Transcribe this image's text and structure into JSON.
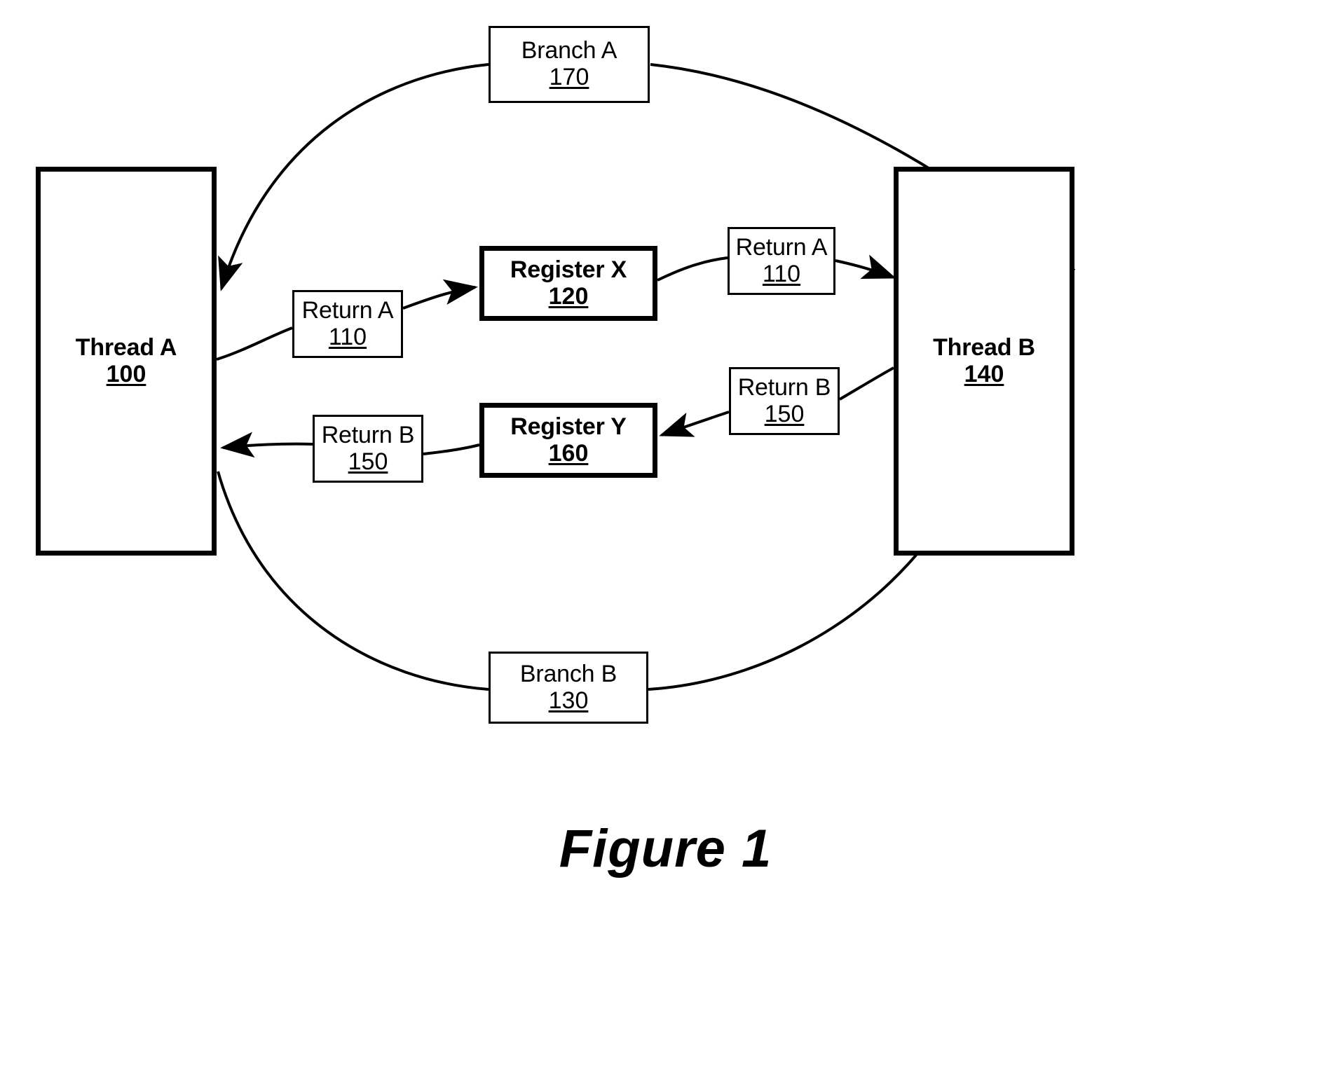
{
  "figure": {
    "caption": "Figure 1"
  },
  "nodes": {
    "branch_a": {
      "label": "Branch A",
      "number": "170"
    },
    "thread_a": {
      "label": "Thread A",
      "number": "100"
    },
    "thread_b": {
      "label": "Thread B",
      "number": "140"
    },
    "register_x": {
      "label": "Register X",
      "number": "120"
    },
    "register_y": {
      "label": "Register Y",
      "number": "160"
    },
    "return_a_left": {
      "label": "Return A",
      "number": "110"
    },
    "return_a_right": {
      "label": "Return A",
      "number": "110"
    },
    "return_b_left": {
      "label": "Return B",
      "number": "150"
    },
    "return_b_right": {
      "label": "Return B",
      "number": "150"
    },
    "branch_b": {
      "label": "Branch B",
      "number": "130"
    }
  },
  "colors": {
    "line": "#000000",
    "background": "#ffffff"
  },
  "edges": [
    {
      "name": "thread-b-to-branch-a-to-thread-a",
      "from": "Thread B",
      "to": "Thread A",
      "via": "Branch A",
      "arrow_at": "Thread A"
    },
    {
      "name": "thread-a-to-return-a-to-register-x",
      "from": "Thread A",
      "to": "Register X",
      "via": "Return A",
      "arrow_at": "Register X"
    },
    {
      "name": "register-x-to-return-a-to-thread-b",
      "from": "Register X",
      "to": "Thread B",
      "via": "Return A",
      "arrow_at": "Thread B"
    },
    {
      "name": "thread-b-to-return-b-to-register-y",
      "from": "Thread B",
      "to": "Register Y",
      "via": "Return B",
      "arrow_at": "Register Y"
    },
    {
      "name": "register-y-to-return-b-to-thread-a",
      "from": "Register Y",
      "to": "Thread A",
      "via": "Return B",
      "arrow_at": "Thread A"
    },
    {
      "name": "thread-a-to-branch-b-to-thread-b",
      "from": "Thread A",
      "to": "Thread B",
      "via": "Branch B",
      "arrow_at": "Thread B"
    }
  ]
}
